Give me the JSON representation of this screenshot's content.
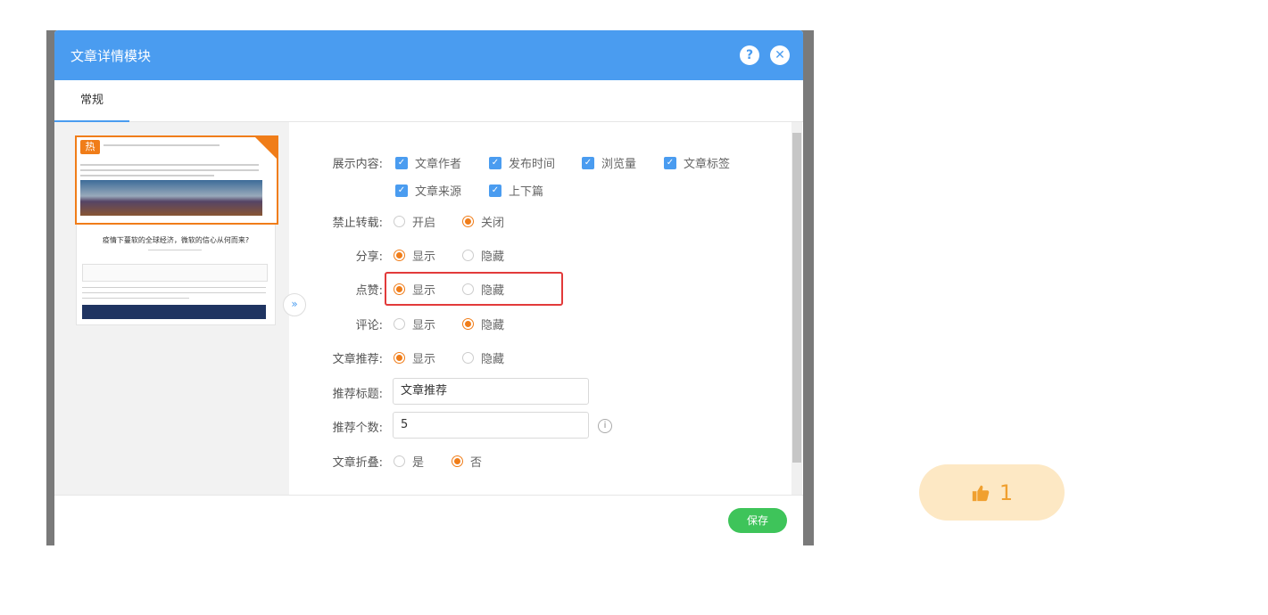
{
  "modal": {
    "title": "文章详情模块",
    "tab": "常规",
    "save_label": "保存",
    "help_icon": "?",
    "close_icon": "✕"
  },
  "preview": {
    "hot_badge": "热",
    "headline": "疫情下蔓软的全球经济，微软的信心从何而来?",
    "expand_glyph": "»"
  },
  "form": {
    "display_content": {
      "label": "展示内容:",
      "options": [
        "文章作者",
        "发布时间",
        "浏览量",
        "文章标签",
        "文章来源",
        "上下篇"
      ]
    },
    "no_repost": {
      "label": "禁止转载:",
      "options": [
        "开启",
        "关闭"
      ],
      "selected": "关闭"
    },
    "share": {
      "label": "分享:",
      "options": [
        "显示",
        "隐藏"
      ],
      "selected": "显示"
    },
    "like": {
      "label": "点赞:",
      "options": [
        "显示",
        "隐藏"
      ],
      "selected": "显示"
    },
    "comment": {
      "label": "评论:",
      "options": [
        "显示",
        "隐藏"
      ],
      "selected": "隐藏"
    },
    "recommend": {
      "label": "文章推荐:",
      "options": [
        "显示",
        "隐藏"
      ],
      "selected": "显示"
    },
    "recommend_title": {
      "label": "推荐标题:",
      "value": "文章推荐"
    },
    "recommend_count": {
      "label": "推荐个数:",
      "value": "5"
    },
    "fold": {
      "label": "文章折叠:",
      "options": [
        "是",
        "否"
      ],
      "selected": "否"
    }
  },
  "like_widget": {
    "count": "1",
    "icon": "thumbs-up-icon"
  },
  "colors": {
    "header": "#4a9cf0",
    "accent": "#f07d19",
    "save": "#3ec45a",
    "highlight": "#e23a3a"
  }
}
